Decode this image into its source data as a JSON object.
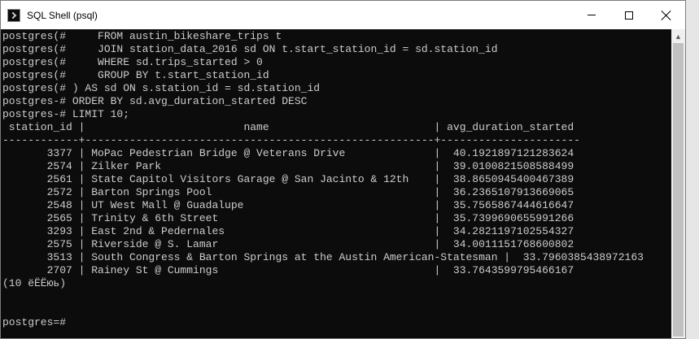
{
  "window": {
    "title": "SQL Shell (psql)"
  },
  "terminal": {
    "lines": [
      "postgres(#     FROM austin_bikeshare_trips t",
      "postgres(#     JOIN station_data_2016 sd ON t.start_station_id = sd.station_id",
      "postgres(#     WHERE sd.trips_started > 0",
      "postgres(#     GROUP BY t.start_station_id",
      "postgres(# ) AS sd ON s.station_id = sd.station_id",
      "postgres-# ORDER BY sd.avg_duration_started DESC",
      "postgres-# LIMIT 10;",
      " station_id |                         name                          | avg_duration_started",
      "------------+-------------------------------------------------------+----------------------",
      "       3377 | MoPac Pedestrian Bridge @ Veterans Drive              |  40.1921897121283624",
      "       2574 | Zilker Park                                           |  39.0100821508588499",
      "       2561 | State Capitol Visitors Garage @ San Jacinto & 12th    |  38.8650945400467389",
      "       2572 | Barton Springs Pool                                   |  36.2365107913669065",
      "       2548 | UT West Mall @ Guadalupe                              |  35.7565867444616647",
      "       2565 | Trinity & 6th Street                                  |  35.7399690655991266",
      "       3293 | East 2nd & Pedernales                                 |  34.2821197102554327",
      "       2575 | Riverside @ S. Lamar                                  |  34.0011151768600802",
      "       3513 | South Congress & Barton Springs at the Austin American-Statesman |  33.7960385438972163",
      "       2707 | Rainey St @ Cummings                                  |  33.7643599795466167",
      "(10 ёЁЁюь)",
      "",
      "",
      "postgres=#"
    ]
  }
}
